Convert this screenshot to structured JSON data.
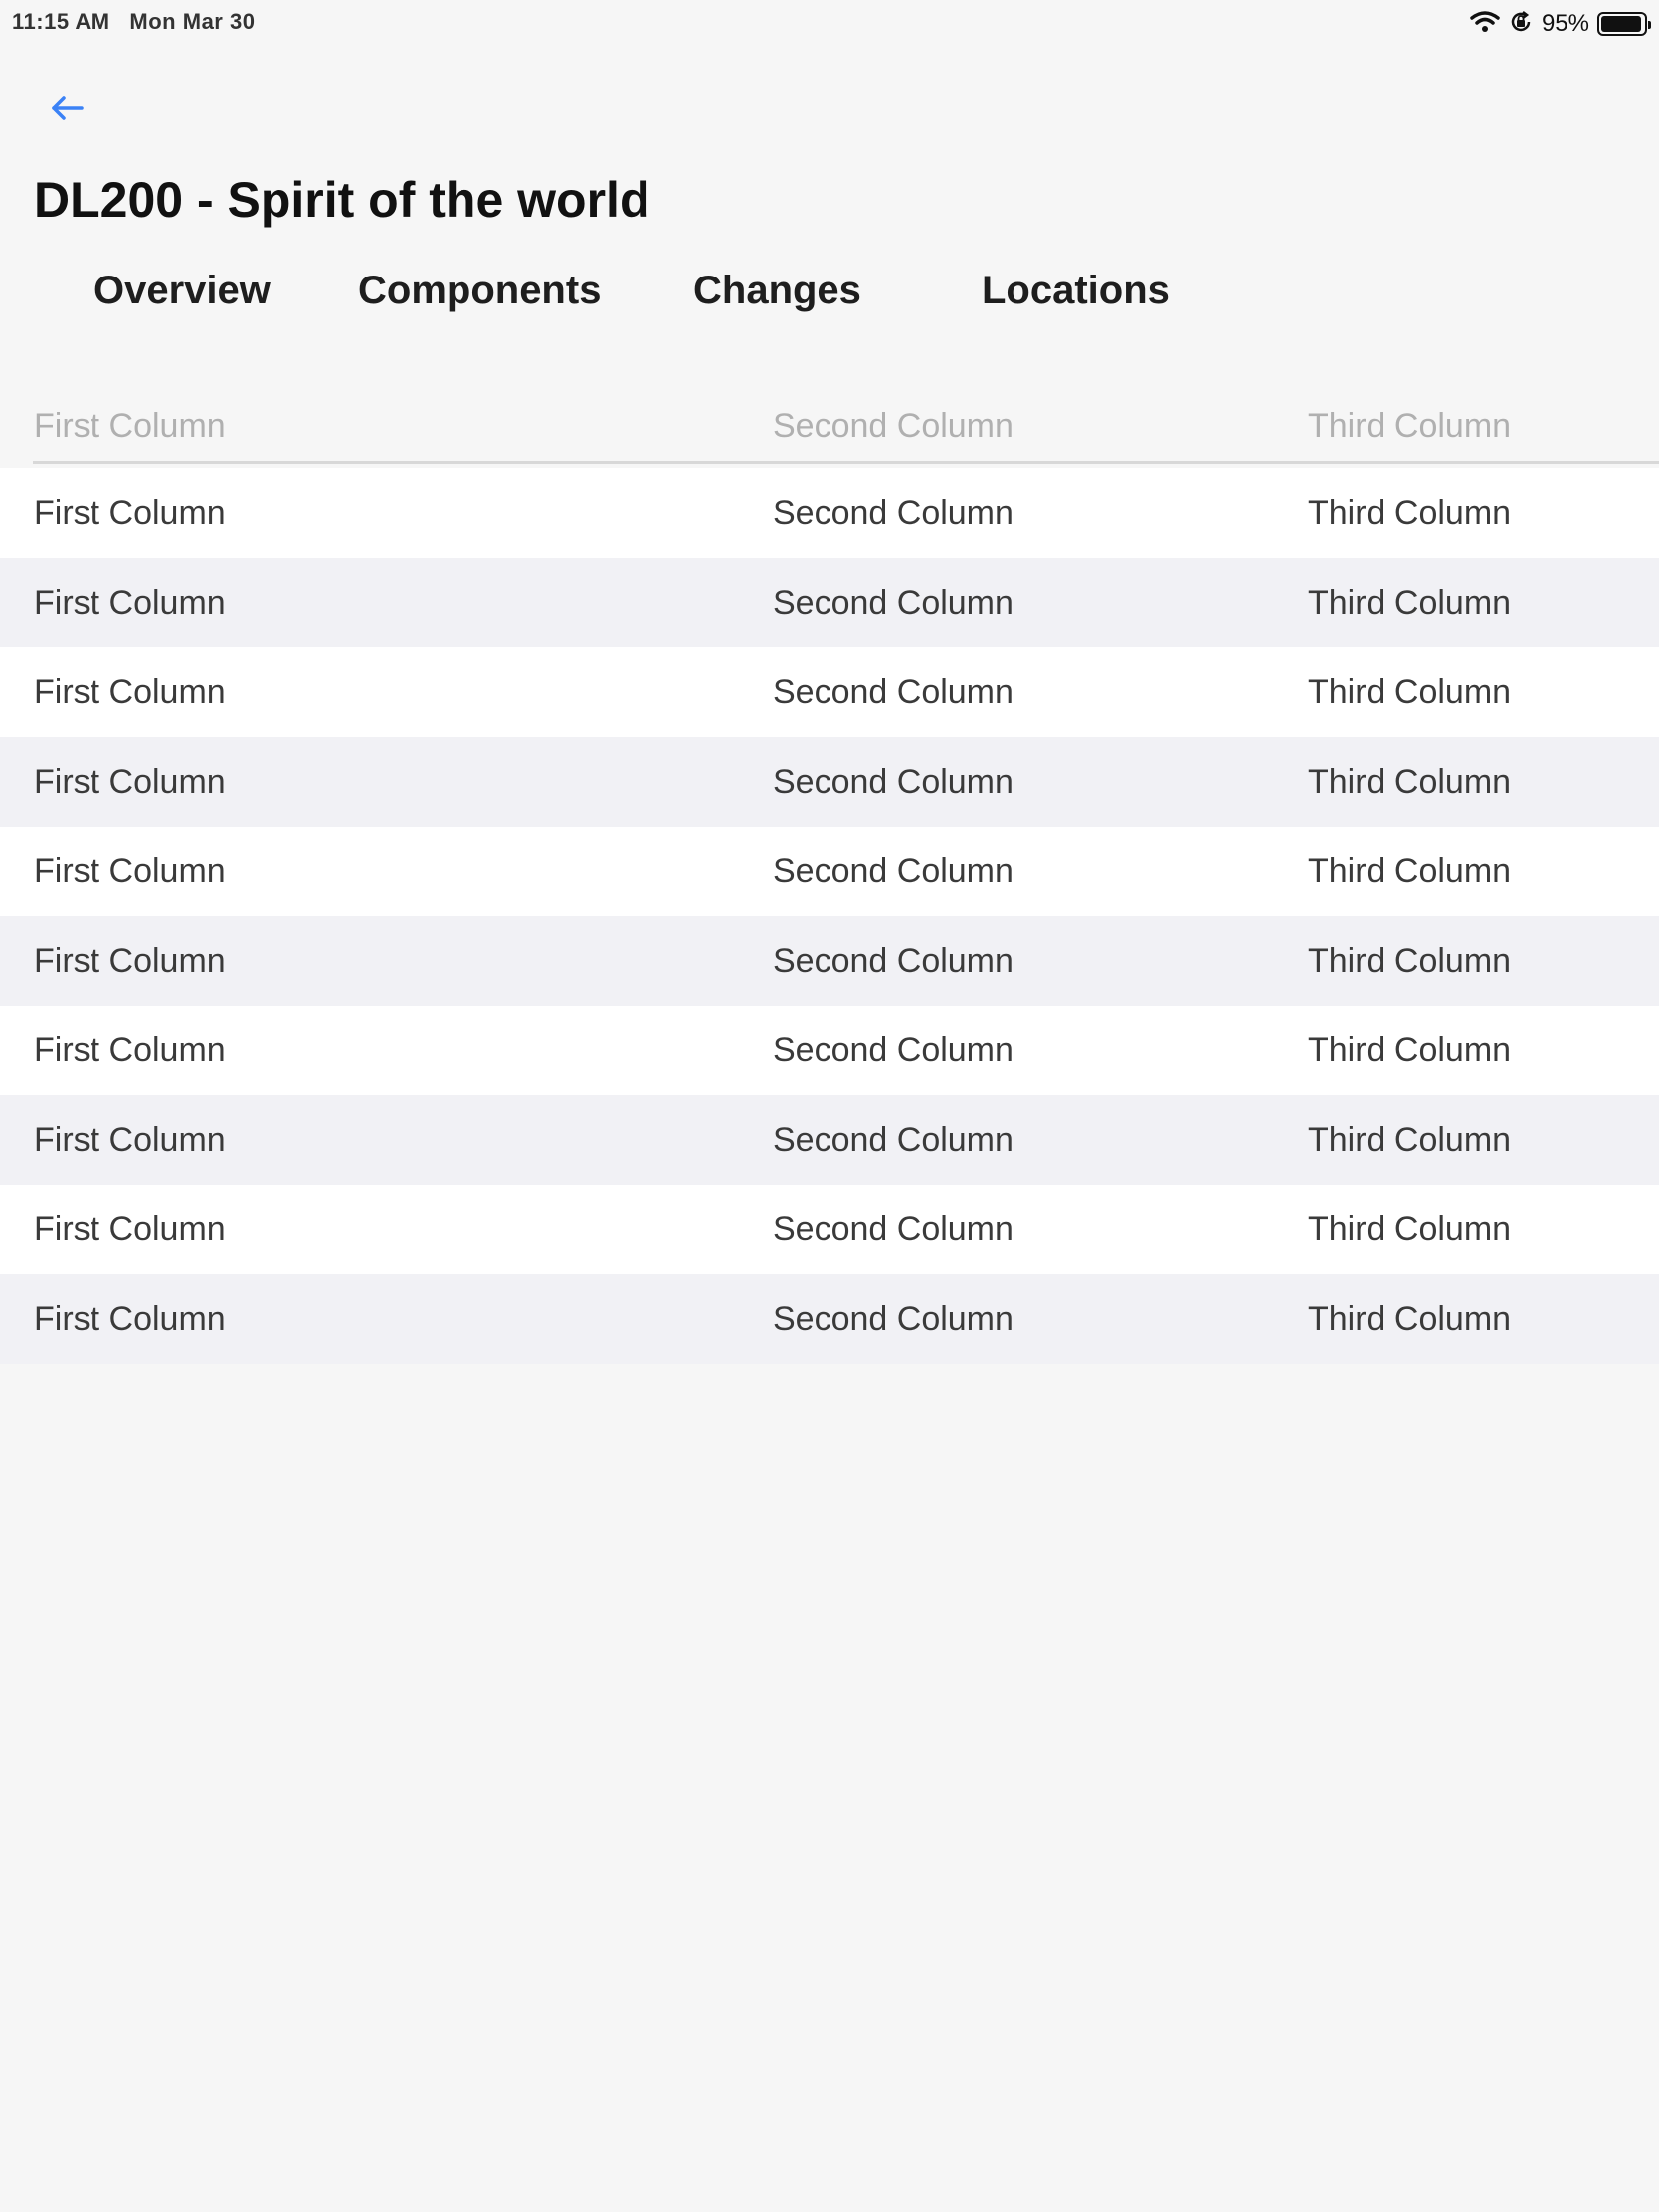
{
  "status_bar": {
    "time": "11:15 AM",
    "date": "Mon Mar 30",
    "battery_percent": "95%",
    "icons": [
      "wifi-icon",
      "orientation-lock-icon",
      "battery-icon"
    ]
  },
  "nav": {
    "back_icon": "arrow-left-icon",
    "accent_color": "#3b82f6"
  },
  "header": {
    "title": "DL200 - Spirit of the world"
  },
  "tabs": [
    {
      "label": "Overview"
    },
    {
      "label": "Components"
    },
    {
      "label": "Changes"
    },
    {
      "label": "Locations"
    }
  ],
  "table": {
    "columns": [
      "First Column",
      "Second Column",
      "Third Column"
    ],
    "rows": [
      [
        "First Column",
        "Second Column",
        "Third Column"
      ],
      [
        "First Column",
        "Second Column",
        "Third Column"
      ],
      [
        "First Column",
        "Second Column",
        "Third Column"
      ],
      [
        "First Column",
        "Second Column",
        "Third Column"
      ],
      [
        "First Column",
        "Second Column",
        "Third Column"
      ],
      [
        "First Column",
        "Second Column",
        "Third Column"
      ],
      [
        "First Column",
        "Second Column",
        "Third Column"
      ],
      [
        "First Column",
        "Second Column",
        "Third Column"
      ],
      [
        "First Column",
        "Second Column",
        "Third Column"
      ],
      [
        "First Column",
        "Second Column",
        "Third Column"
      ]
    ]
  }
}
